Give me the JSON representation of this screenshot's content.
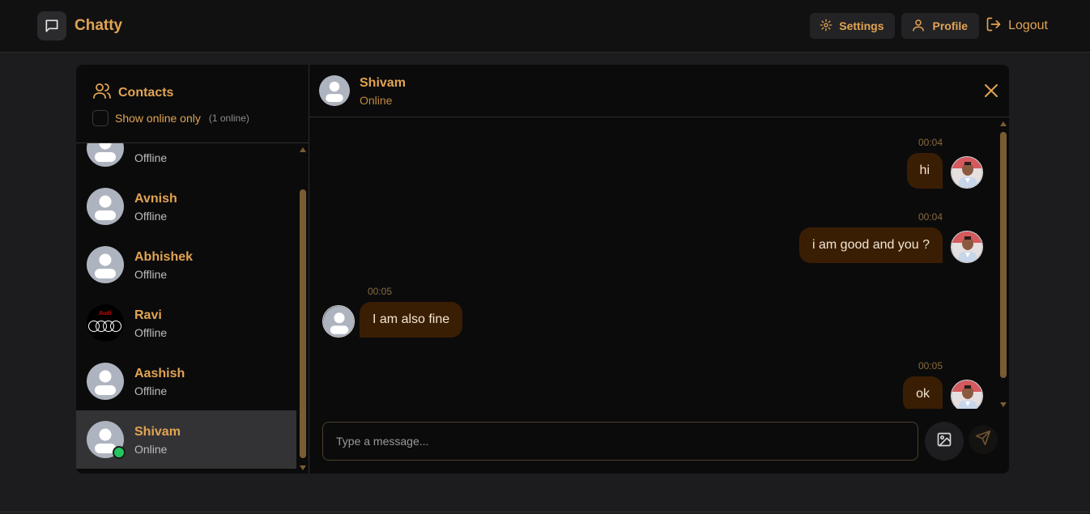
{
  "app": {
    "name": "Chatty"
  },
  "nav": {
    "settings_label": "Settings",
    "profile_label": "Profile",
    "logout_label": "Logout"
  },
  "sidebar": {
    "title": "Contacts",
    "filter_label": "Show online only",
    "online_count": "(1 online)",
    "contacts": [
      {
        "name": "",
        "status": "Offline"
      },
      {
        "name": "Avnish",
        "status": "Offline"
      },
      {
        "name": "Abhishek",
        "status": "Offline"
      },
      {
        "name": "Ravi",
        "status": "Offline",
        "avatar_text": "Audi"
      },
      {
        "name": "Aashish",
        "status": "Offline"
      },
      {
        "name": "Shivam",
        "status": "Online",
        "selected": true
      }
    ]
  },
  "chat": {
    "name": "Shivam",
    "status": "Online",
    "messages": [
      {
        "time": "00:04",
        "text": "hi",
        "side": "right"
      },
      {
        "time": "00:04",
        "text": "i am good and you ?",
        "side": "right"
      },
      {
        "time": "00:05",
        "text": "I am also fine",
        "side": "left"
      },
      {
        "time": "00:05",
        "text": "ok",
        "side": "right"
      }
    ],
    "input_placeholder": "Type a message..."
  },
  "colors": {
    "accent": "#e2a452",
    "bubble": "#3a1e04",
    "online": "#22c55e",
    "background": "#1c1c1e"
  }
}
